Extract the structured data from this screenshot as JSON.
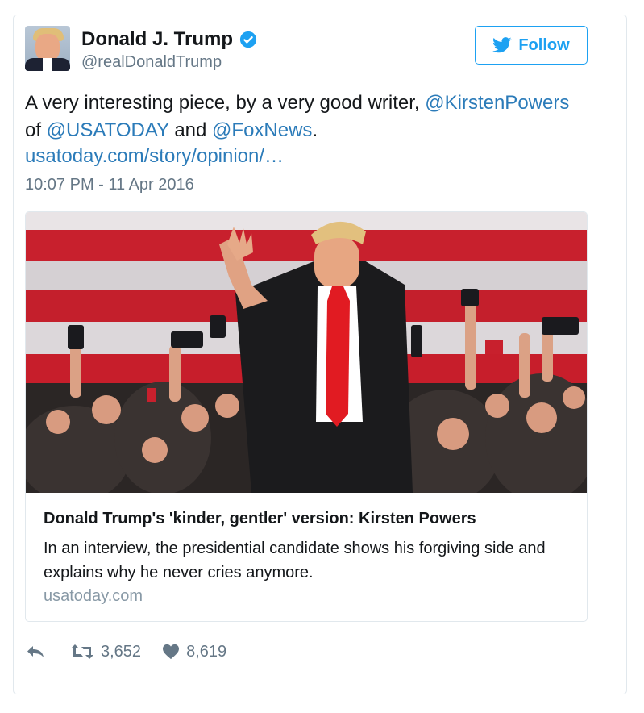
{
  "author": {
    "name": "Donald J. Trump",
    "handle": "@realDonaldTrump",
    "verified": true
  },
  "follow_button": {
    "label": "Follow",
    "icon": "twitter-bird-icon"
  },
  "tweet": {
    "text_parts": {
      "p1": "A very interesting piece, by a very good writer, ",
      "m1": "@KirstenPowers",
      "p2": "of ",
      "m2": "@USATODAY",
      "p3": " and ",
      "m3": "@FoxNews",
      "p4": "."
    },
    "link": "usatoday.com/story/opinion/…",
    "timestamp": "10:07 PM - 11 Apr 2016"
  },
  "link_card": {
    "title": "Donald Trump's 'kinder, gentler' version: Kirsten Powers",
    "description": "In an interview, the presidential candidate shows his forgiving side and explains why he never cries anymore.",
    "domain": "usatoday.com"
  },
  "actions": {
    "reply_icon": "reply-icon",
    "retweet_icon": "retweet-icon",
    "retweet_count": "3,652",
    "like_icon": "heart-icon",
    "like_count": "8,619"
  },
  "colors": {
    "link_blue": "#2b7bb9",
    "twitter_blue": "#1da1f2",
    "muted_gray": "#657786"
  }
}
